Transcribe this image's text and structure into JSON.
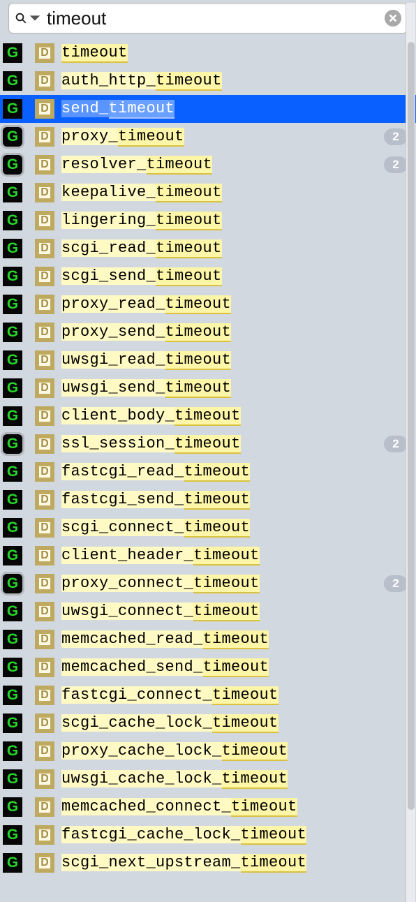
{
  "search": {
    "query": "timeout",
    "placeholder": ""
  },
  "icons": {
    "primary_letter": "G",
    "secondary_letter": "D"
  },
  "highlight_term": "timeout",
  "selected_index": 2,
  "items": [
    {
      "name": "timeout",
      "badge": null,
      "open": false
    },
    {
      "name": "auth_http_timeout",
      "badge": null,
      "open": false
    },
    {
      "name": "send_timeout",
      "badge": null,
      "open": false
    },
    {
      "name": "proxy_timeout",
      "badge": "2",
      "open": true
    },
    {
      "name": "resolver_timeout",
      "badge": "2",
      "open": true
    },
    {
      "name": "keepalive_timeout",
      "badge": null,
      "open": false
    },
    {
      "name": "lingering_timeout",
      "badge": null,
      "open": false
    },
    {
      "name": "scgi_read_timeout",
      "badge": null,
      "open": false
    },
    {
      "name": "scgi_send_timeout",
      "badge": null,
      "open": false
    },
    {
      "name": "proxy_read_timeout",
      "badge": null,
      "open": false
    },
    {
      "name": "proxy_send_timeout",
      "badge": null,
      "open": false
    },
    {
      "name": "uwsgi_read_timeout",
      "badge": null,
      "open": false
    },
    {
      "name": "uwsgi_send_timeout",
      "badge": null,
      "open": false
    },
    {
      "name": "client_body_timeout",
      "badge": null,
      "open": false
    },
    {
      "name": "ssl_session_timeout",
      "badge": "2",
      "open": true
    },
    {
      "name": "fastcgi_read_timeout",
      "badge": null,
      "open": false
    },
    {
      "name": "fastcgi_send_timeout",
      "badge": null,
      "open": false
    },
    {
      "name": "scgi_connect_timeout",
      "badge": null,
      "open": false
    },
    {
      "name": "client_header_timeout",
      "badge": null,
      "open": false
    },
    {
      "name": "proxy_connect_timeout",
      "badge": "2",
      "open": true
    },
    {
      "name": "uwsgi_connect_timeout",
      "badge": null,
      "open": false
    },
    {
      "name": "memcached_read_timeout",
      "badge": null,
      "open": false
    },
    {
      "name": "memcached_send_timeout",
      "badge": null,
      "open": false
    },
    {
      "name": "fastcgi_connect_timeout",
      "badge": null,
      "open": false
    },
    {
      "name": "scgi_cache_lock_timeout",
      "badge": null,
      "open": false
    },
    {
      "name": "proxy_cache_lock_timeout",
      "badge": null,
      "open": false
    },
    {
      "name": "uwsgi_cache_lock_timeout",
      "badge": null,
      "open": false
    },
    {
      "name": "memcached_connect_timeout",
      "badge": null,
      "open": false
    },
    {
      "name": "fastcgi_cache_lock_timeout",
      "badge": null,
      "open": false
    },
    {
      "name": "scgi_next_upstream_timeout",
      "badge": null,
      "open": false
    }
  ]
}
